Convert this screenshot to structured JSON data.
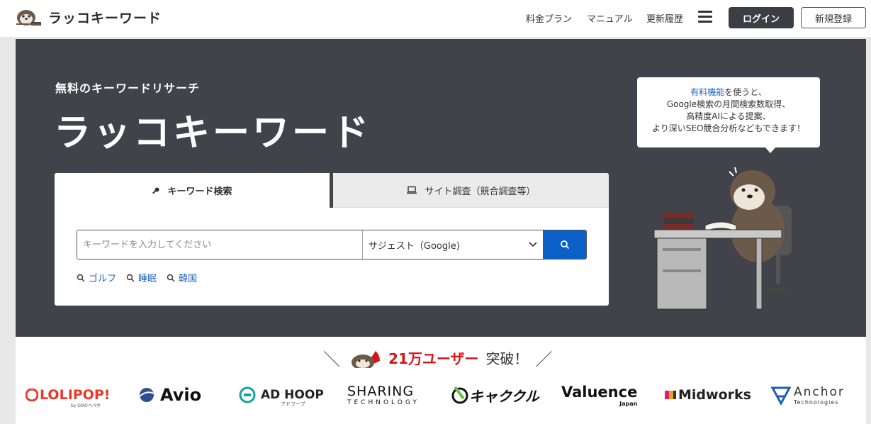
{
  "header": {
    "logo_text": "ラッコキーワード",
    "nav": [
      "料金プラン",
      "マニュアル",
      "更新履歴"
    ],
    "login": "ログイン",
    "signup": "新規登録"
  },
  "hero": {
    "subtitle": "無料のキーワードリサーチ",
    "title": "ラッコキーワード",
    "tabs": {
      "keyword": "キーワード検索",
      "site": "サイト調査（競合調査等）"
    },
    "search": {
      "placeholder": "キーワードを入力してください",
      "source": "サジェスト（Google)"
    },
    "suggestions": [
      "ゴルフ",
      "睡眠",
      "韓国"
    ],
    "bubble": {
      "highlight": "有料機能",
      "line1_rest": "を使うと、",
      "line2": "Google検索の月間検索数取得、",
      "line3": "高精度AIによる提案、",
      "line4": "より深いSEO競合分析などもできます！"
    }
  },
  "users": {
    "count": "21万ユーザー",
    "suffix": "突破！"
  },
  "logos": {
    "lolipop": "LOLIPOP!",
    "lolipop_sub": "by GMOペパボ",
    "avio": "Avio",
    "adhoop": "AD HOOP",
    "adhoop_sub": "アドフープ",
    "sharing_top": "SHARING",
    "sharing_bottom": "TECHNOLOGY",
    "kyakukuru": "キャククル",
    "valuence": "Valuence",
    "valuence_sub": "Japan",
    "midworks": "Midworks",
    "anchor": "Anchor",
    "anchor_sub": "Technologies"
  },
  "colors": {
    "hero_bg": "#42434a",
    "accent_blue": "#0b60c8",
    "link_blue": "#2063c0",
    "red": "#d71418"
  }
}
